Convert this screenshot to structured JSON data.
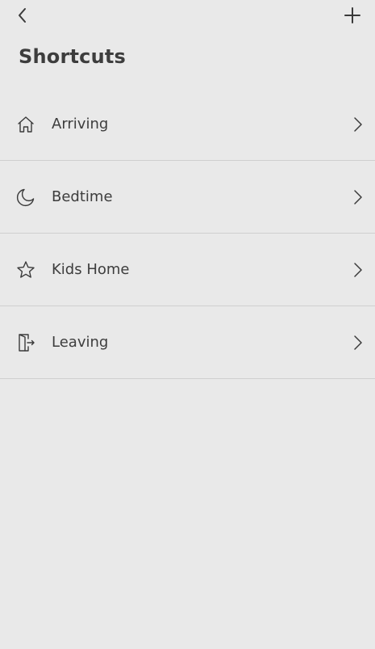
{
  "header": {
    "title": "Shortcuts",
    "back_icon": "chevron-left-icon",
    "add_icon": "plus-icon"
  },
  "shortcuts": [
    {
      "label": "Arriving",
      "icon": "home-icon"
    },
    {
      "label": "Bedtime",
      "icon": "moon-icon"
    },
    {
      "label": "Kids Home",
      "icon": "star-icon"
    },
    {
      "label": "Leaving",
      "icon": "door-exit-icon"
    }
  ],
  "colors": {
    "background": "#e9e9e9",
    "divider": "#cfcfcf",
    "text": "#3d3d3d"
  }
}
